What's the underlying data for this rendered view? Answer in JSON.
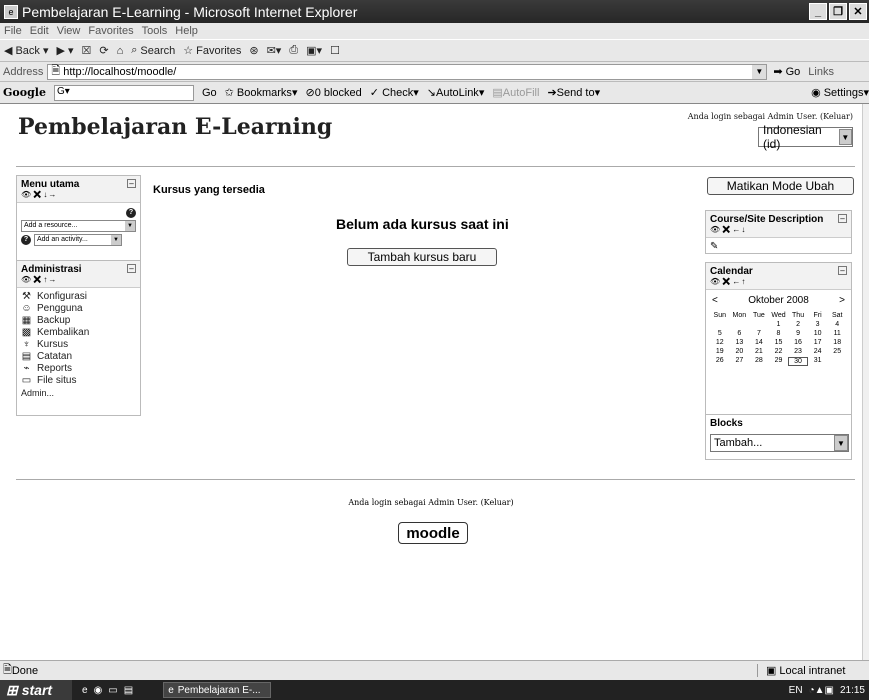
{
  "window": {
    "title": "Pembelajaran E-Learning - Microsoft Internet Explorer"
  },
  "menu": [
    "File",
    "Edit",
    "View",
    "Favorites",
    "Tools",
    "Help"
  ],
  "toolbar": {
    "back": "Back",
    "search": "Search",
    "favorites": "Favorites"
  },
  "address": {
    "label": "Address",
    "url": "http://localhost/moodle/",
    "go": "Go",
    "links": "Links"
  },
  "google": {
    "logo": "Google",
    "go": "Go",
    "bookmarks": "Bookmarks",
    "blocked": "0 blocked",
    "check": "Check",
    "autolink": "AutoLink",
    "autofill": "AutoFill",
    "send": "Send to",
    "settings": "Settings"
  },
  "site": {
    "title": "Pembelajaran E-Learning",
    "login_info": "Anda login sebagai Admin User. (Keluar)",
    "language": "Indonesian (id)"
  },
  "menu_utama": {
    "title": "Menu utama",
    "add_resource": "Add a resource...",
    "add_activity": "Add an activity..."
  },
  "admin": {
    "title": "Administrasi",
    "items": [
      "Konfigurasi",
      "Pengguna",
      "Backup",
      "Kembalikan",
      "Kursus",
      "Catatan",
      "Reports",
      "File situs"
    ],
    "more": "Admin..."
  },
  "main": {
    "courses_title": "Kursus yang tersedia",
    "no_course": "Belum ada kursus saat ini",
    "add_course": "Tambah kursus baru"
  },
  "edit_mode": "Matikan Mode Ubah",
  "site_desc": {
    "title": "Course/Site Description"
  },
  "calendar": {
    "title": "Calendar",
    "month": "Oktober 2008",
    "prev": "<",
    "next": ">",
    "days": [
      "Sun",
      "Mon",
      "Tue",
      "Wed",
      "Thu",
      "Fri",
      "Sat"
    ],
    "cells": [
      "",
      "",
      "",
      "1",
      "2",
      "3",
      "4",
      "5",
      "6",
      "7",
      "8",
      "9",
      "10",
      "11",
      "12",
      "13",
      "14",
      "15",
      "16",
      "17",
      "18",
      "19",
      "20",
      "21",
      "22",
      "23",
      "24",
      "25",
      "26",
      "27",
      "28",
      "29",
      "30",
      "31",
      ""
    ],
    "today": "30"
  },
  "blocks": {
    "title": "Blocks",
    "add": "Tambah..."
  },
  "footer": {
    "login_info": "Anda login sebagai Admin User. (Keluar)",
    "logo": "moodle"
  },
  "status": {
    "text": "Done",
    "zone": "Local intranet"
  },
  "taskbar": {
    "start": "start",
    "task": "Pembelajaran E-...",
    "lang": "EN",
    "time": "21:15"
  }
}
